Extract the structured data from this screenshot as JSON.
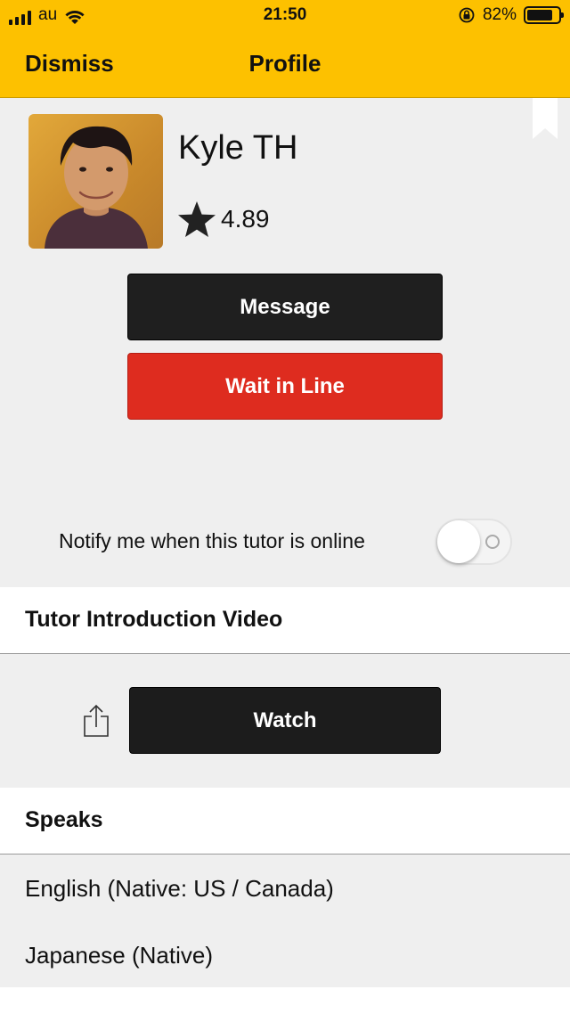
{
  "status_bar": {
    "carrier": "au",
    "time": "21:50",
    "battery_percent": "82%",
    "battery_level": 0.82,
    "icons": [
      "signal-icon",
      "wifi-icon",
      "orientation-lock-icon",
      "battery-icon"
    ]
  },
  "nav": {
    "dismiss_label": "Dismiss",
    "title": "Profile"
  },
  "tutor": {
    "name": "Kyle TH",
    "rating": "4.89"
  },
  "actions": {
    "message_label": "Message",
    "wait_label": "Wait in Line"
  },
  "notify": {
    "label": "Notify me when this tutor is online",
    "enabled": false
  },
  "video_section": {
    "header": "Tutor Introduction Video",
    "watch_label": "Watch"
  },
  "speaks_section": {
    "header": "Speaks",
    "languages": [
      "English (Native: US / Canada)",
      "Japanese (Native)"
    ]
  },
  "colors": {
    "brand_yellow": "#fdc100",
    "message_button": "#1f1f1f",
    "wait_button": "#de2c1f",
    "background": "#efefef"
  }
}
